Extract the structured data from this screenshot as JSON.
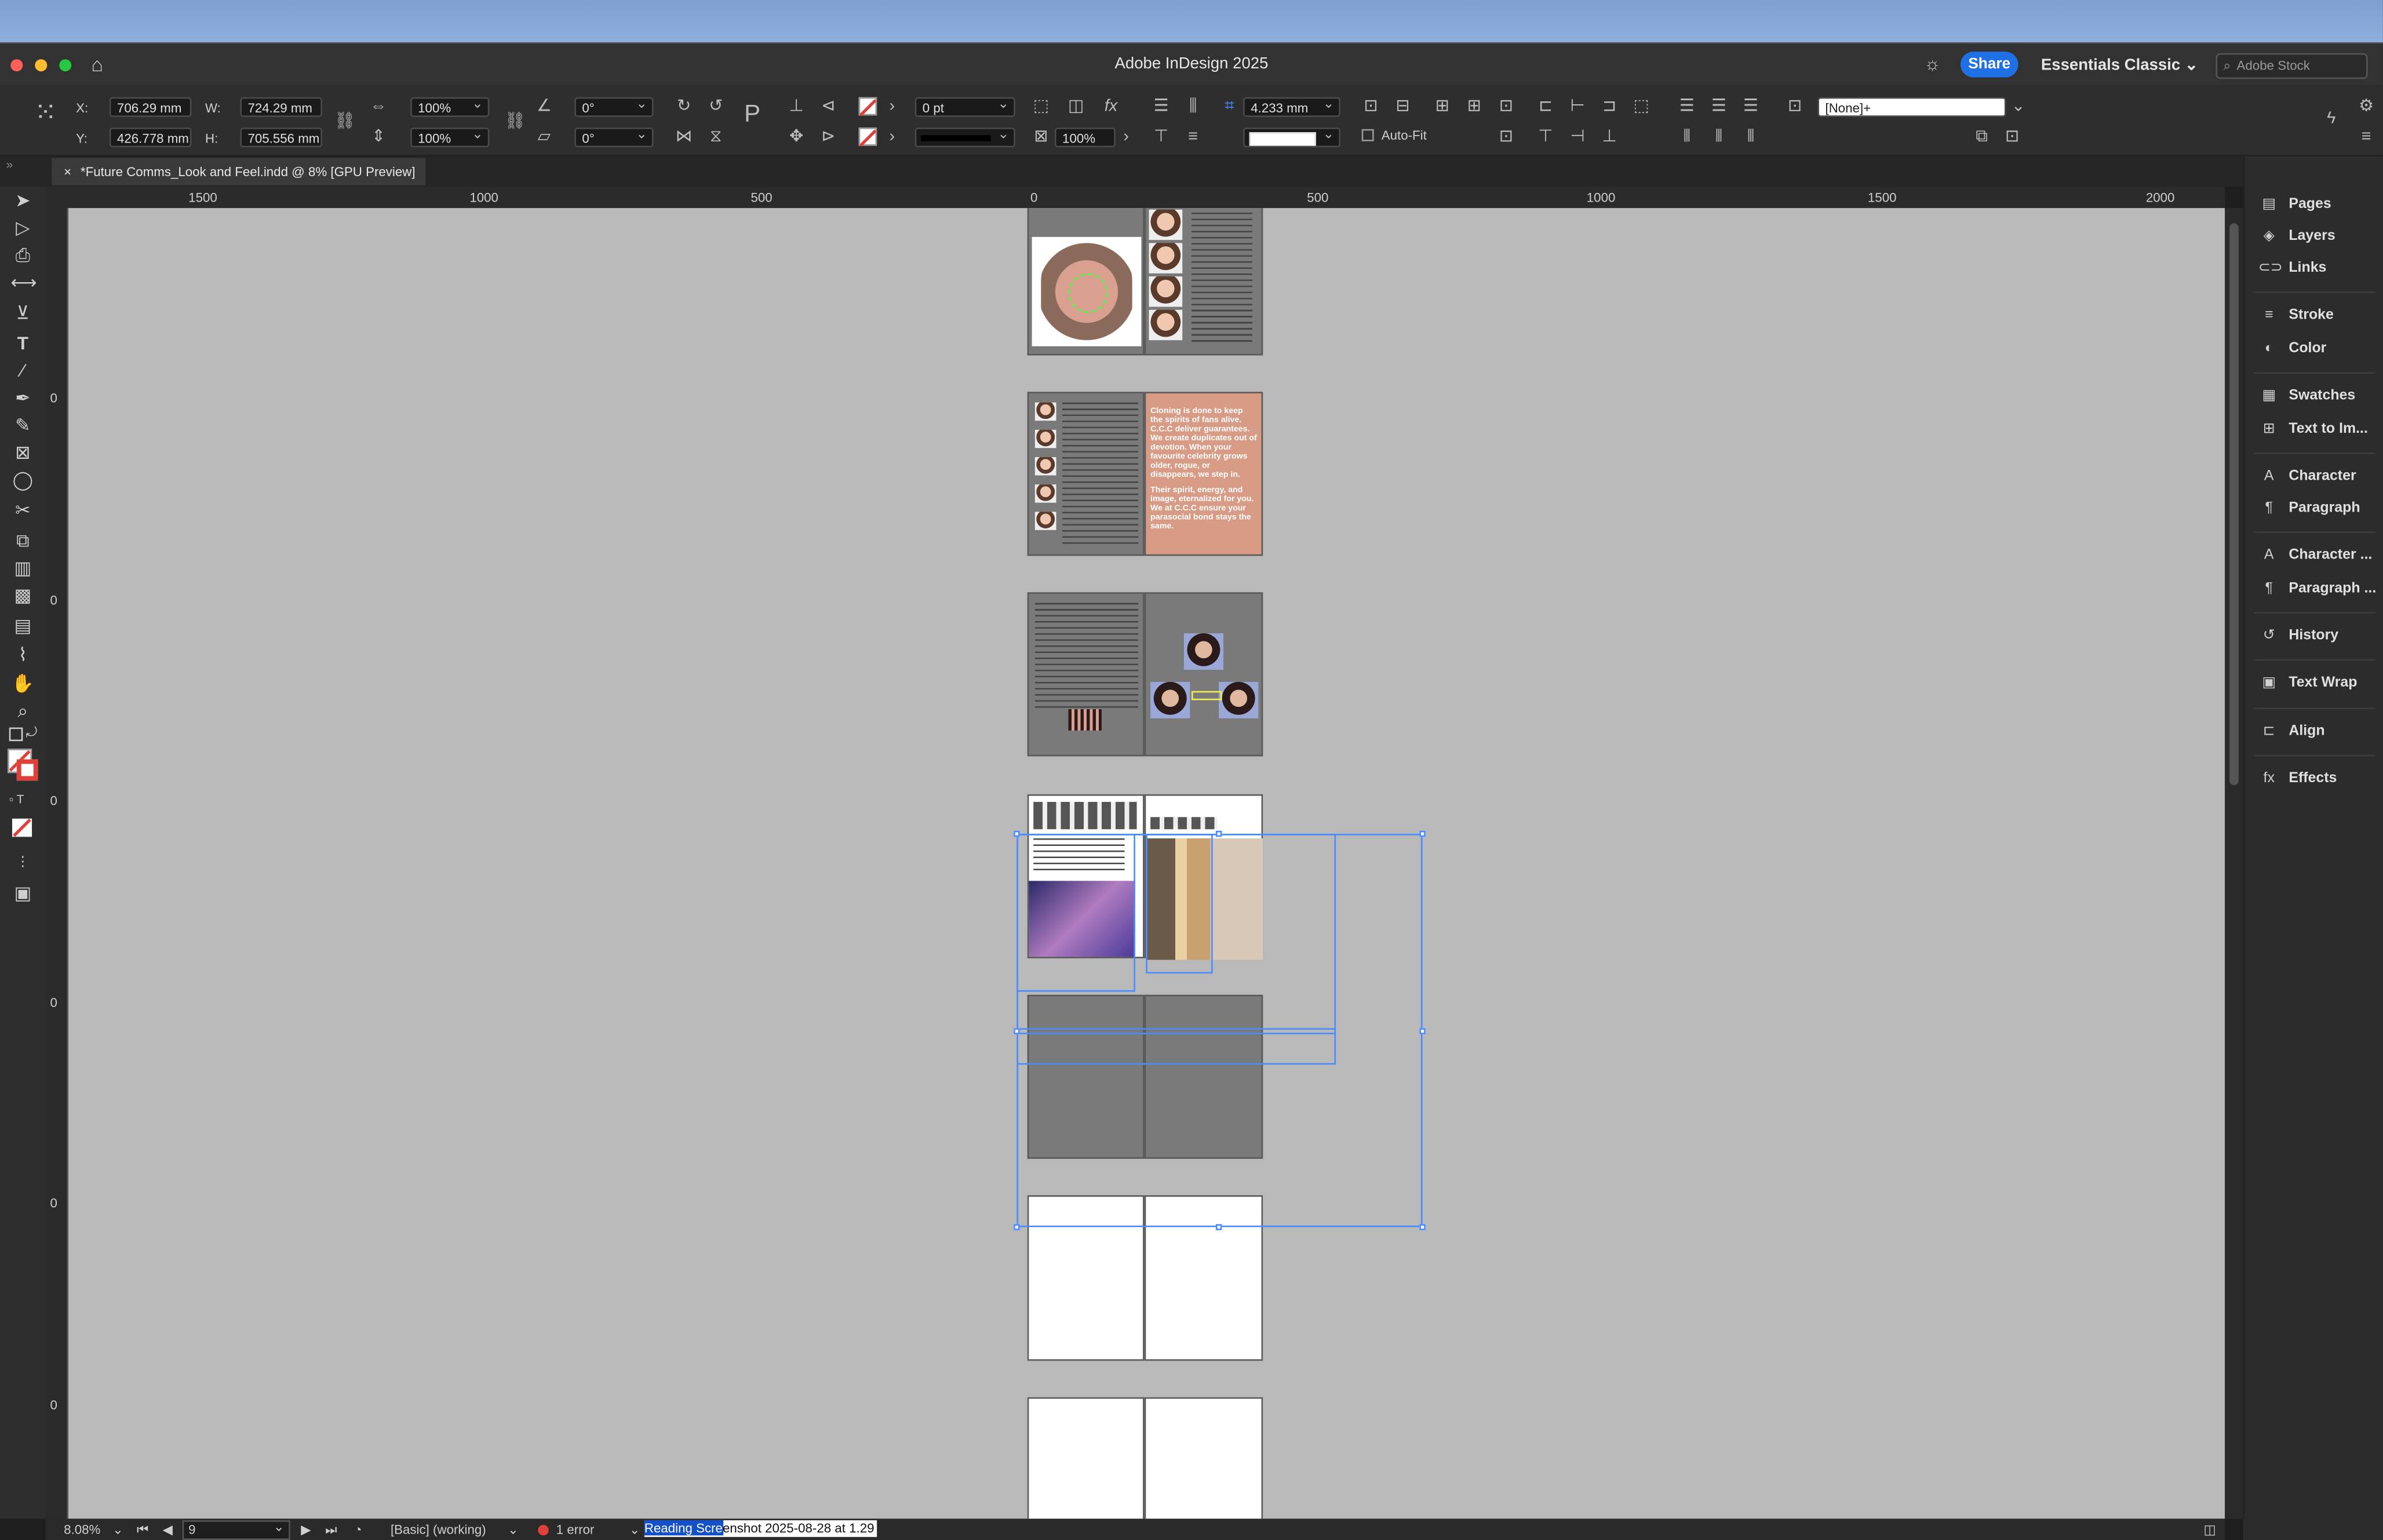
{
  "window": {
    "title": "Adobe InDesign 2025"
  },
  "titlebar": {
    "share_label": "Share",
    "workspace_label": "Essentials Classic",
    "search_placeholder": "Adobe Stock"
  },
  "control": {
    "x_label": "X:",
    "x_value": "706.29 mm",
    "y_label": "Y:",
    "y_value": "426.778 mm",
    "w_label": "W:",
    "w_value": "724.29 mm",
    "h_label": "H:",
    "h_value": "705.556 mm",
    "scale_x": "100%",
    "scale_y": "100%",
    "rotate": "0°",
    "shear": "0°",
    "stroke_weight": "0 pt",
    "opacity": "100%",
    "gap": "4.233 mm",
    "autofit_label": "Auto-Fit",
    "object_style": "[None]+"
  },
  "tab": {
    "label": "*Future Comms_Look and Feel.indd @ 8% [GPU Preview]"
  },
  "ruler": {
    "h_labels": [
      "1500",
      "1000",
      "500",
      "0",
      "500",
      "1000",
      "1500",
      "2000"
    ],
    "v_labels": [
      "0",
      "0",
      "0",
      "0",
      "0",
      "0"
    ]
  },
  "spread_text": {
    "para1": "Cloning is done to keep the spirits of fans alive. C.C.C deliver guarantees. We create duplicates out of devotion. When your favourite celebrity grows older, rogue, or disappears, we step in.",
    "para2": "Their spirit, energy, and image, eternalized for you. We at C.C.C ensure your parasocial bond stays the same."
  },
  "panels": [
    {
      "label": "Pages",
      "icon": "pages-icon",
      "glyph": "▤"
    },
    {
      "label": "Layers",
      "icon": "layers-icon",
      "glyph": "◈"
    },
    {
      "label": "Links",
      "icon": "links-icon",
      "glyph": "⊂⊃"
    },
    {
      "label": "Stroke",
      "icon": "stroke-icon",
      "glyph": "≡"
    },
    {
      "label": "Color",
      "icon": "color-icon",
      "glyph": "◐"
    },
    {
      "label": "Swatches",
      "icon": "swatches-icon",
      "glyph": "▦"
    },
    {
      "label": "Text to Im...",
      "icon": "text-to-image-icon",
      "glyph": "⊞"
    },
    {
      "label": "Character",
      "icon": "character-icon",
      "glyph": "A"
    },
    {
      "label": "Paragraph",
      "icon": "paragraph-icon",
      "glyph": "¶"
    },
    {
      "label": "Character ...",
      "icon": "character-styles-icon",
      "glyph": "A"
    },
    {
      "label": "Paragraph ...",
      "icon": "paragraph-styles-icon",
      "glyph": "¶"
    },
    {
      "label": "History",
      "icon": "history-icon",
      "glyph": "↺"
    },
    {
      "label": "Text Wrap",
      "icon": "text-wrap-icon",
      "glyph": "▣"
    },
    {
      "label": "Align",
      "icon": "align-icon",
      "glyph": "⊏"
    },
    {
      "label": "Effects",
      "icon": "effects-icon",
      "glyph": "fx"
    }
  ],
  "status": {
    "zoom": "8.08%",
    "page": "9",
    "profile": "[Basic] (working)",
    "errors": "1 error",
    "edit_highlight": "Reading Scre",
    "edit_rest": "enshot 2025-08-28 at 1.29"
  },
  "colors": {
    "accent": "#1f6fe5",
    "selection": "#4a8cff",
    "error": "#e0403a",
    "pink_page": "#d89c86",
    "green_text": "#8aff5a"
  }
}
